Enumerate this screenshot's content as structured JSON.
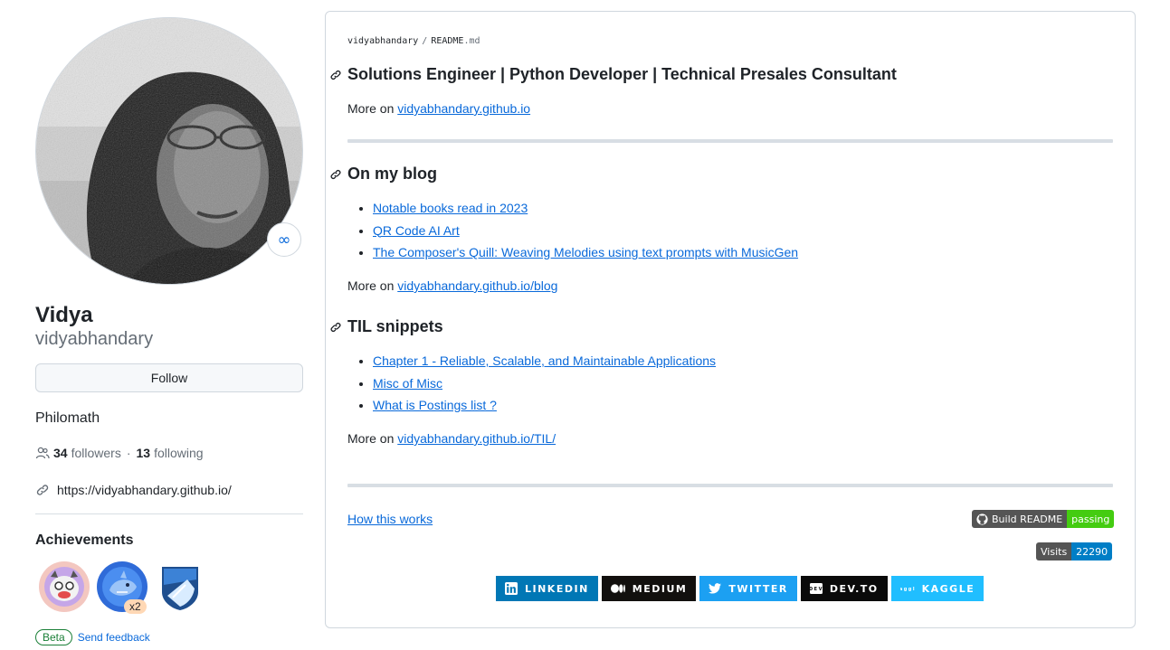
{
  "profile": {
    "name": "Vidya",
    "username": "vidyabhandary",
    "follow_label": "Follow",
    "bio": "Philomath",
    "followers_count": "34",
    "followers_label": "followers",
    "following_count": "13",
    "following_label": "following",
    "separator": "·",
    "website": "https://vidyabhandary.github.io/",
    "status_emoji": "∞"
  },
  "achievements": {
    "title": "Achievements",
    "badges": [
      {
        "name": "yolo",
        "multiplier": ""
      },
      {
        "name": "shark",
        "multiplier": "x2"
      },
      {
        "name": "arctic",
        "multiplier": ""
      }
    ],
    "beta_label": "Beta",
    "feedback_label": "Send feedback"
  },
  "readme": {
    "owner": "vidyabhandary",
    "sep": "/",
    "file_base": "README",
    "file_ext": ".md",
    "heading1": "Solutions Engineer | Python Developer | Technical Presales Consultant",
    "more_prefix": "More on",
    "more1_link": "vidyabhandary.github.io",
    "heading2": "On my blog",
    "blog_posts": [
      "Notable books read in 2023",
      "QR Code AI Art",
      "The Composer's Quill: Weaving Melodies using text prompts with MusicGen"
    ],
    "more2_link": "vidyabhandary.github.io/blog",
    "heading3": "TIL snippets",
    "til_posts": [
      "Chapter 1 - Reliable, Scalable, and Maintainable Applications",
      "Misc of Misc",
      "What is Postings list ?"
    ],
    "more3_link": "vidyabhandary.github.io/TIL/",
    "how_this_works": "How this works",
    "build_badge": {
      "label": "Build README",
      "status": "passing",
      "status_color": "#4c1"
    },
    "visits_badge": {
      "label": "Visits",
      "count": "22290",
      "color": "#007ec6"
    },
    "socials": [
      {
        "label": "LINKEDIN",
        "color": "#0077b5",
        "icon": "linkedin-icon"
      },
      {
        "label": "MEDIUM",
        "color": "#12100e",
        "icon": "medium-icon"
      },
      {
        "label": "TWITTER",
        "color": "#1ca0f2",
        "icon": "twitter-icon"
      },
      {
        "label": "DEV.TO",
        "color": "#0a0a0a",
        "icon": "devto-icon"
      },
      {
        "label": "KAGGLE",
        "color": "#20beff",
        "icon": "kaggle-icon"
      }
    ]
  }
}
